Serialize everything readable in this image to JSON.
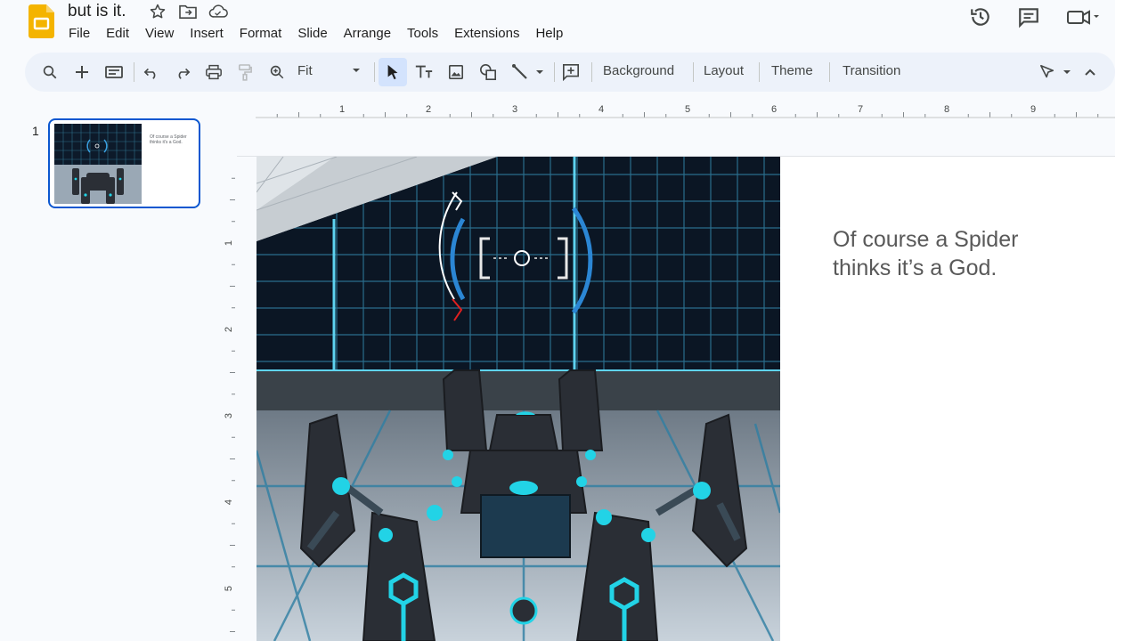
{
  "document": {
    "title": "but is it."
  },
  "menu": {
    "items": [
      "File",
      "Edit",
      "View",
      "Insert",
      "Format",
      "Slide",
      "Arrange",
      "Tools",
      "Extensions",
      "Help"
    ]
  },
  "toolbar": {
    "zoom_label": "Fit",
    "background_label": "Background",
    "layout_label": "Layout",
    "theme_label": "Theme",
    "transition_label": "Transition"
  },
  "ruler": {
    "h_labels": [
      "1",
      "2",
      "3",
      "4",
      "5",
      "6",
      "7",
      "8",
      "9"
    ],
    "v_labels": [
      "1",
      "2",
      "3",
      "4",
      "5"
    ]
  },
  "filmstrip": {
    "slides": [
      {
        "number": "1",
        "text": "Of course a Spider thinks it's a God."
      }
    ]
  },
  "slide": {
    "text": "Of course a Spider\nthinks it’s a God."
  },
  "colors": {
    "accent": "#0b57d0",
    "toolbar_bg": "#edf2fa",
    "slides_logo": "#f4b400",
    "text_gray": "#595959"
  },
  "icons": {
    "title": [
      "star-icon",
      "move-to-folder-icon",
      "cloud-saved-icon"
    ],
    "header_right": [
      "version-history-icon",
      "comments-icon",
      "meet-icon"
    ],
    "toolbar": [
      "search-icon",
      "new-slide-icon",
      "slide-layout-icon",
      "undo-icon",
      "redo-icon",
      "print-icon",
      "paint-format-icon",
      "zoom-icon",
      "select-icon",
      "text-box-icon",
      "image-icon",
      "shape-icon",
      "line-icon",
      "comment-add-icon",
      "pointer-mode-icon",
      "collapse-icon"
    ]
  }
}
